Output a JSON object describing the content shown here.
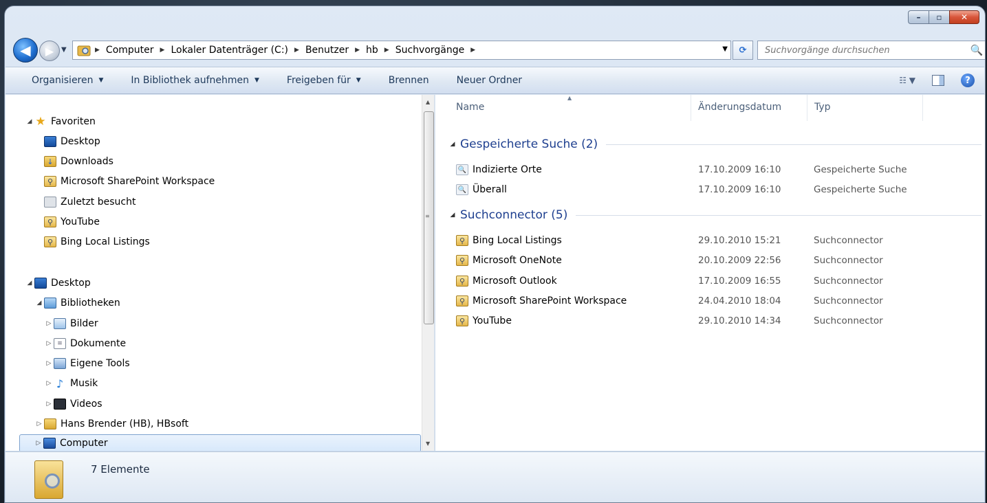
{
  "window": {
    "caption": {
      "minimize": "–",
      "maximize": "▫",
      "close": "✕"
    }
  },
  "nav": {
    "back": "◀",
    "forward": "▶",
    "history": "▼",
    "refresh": "⟳"
  },
  "address": {
    "crumbs": [
      "Computer",
      "Lokaler Datenträger (C:)",
      "Benutzer",
      "hb",
      "Suchvorgänge"
    ],
    "separator": "▶",
    "dropdown": "▼"
  },
  "search": {
    "placeholder": "Suchvorgänge durchsuchen",
    "icon": "🔍"
  },
  "toolbar": {
    "organize": "Organisieren",
    "include_library": "In Bibliothek aufnehmen",
    "share_with": "Freigeben für",
    "burn": "Brennen",
    "new_folder": "Neuer Ordner",
    "dropdown_glyph": "▼",
    "view_glyph": "☷ ▼",
    "help_glyph": "?"
  },
  "navpane": {
    "favorites": {
      "label": "Favoriten",
      "items": [
        "Desktop",
        "Downloads",
        "Microsoft SharePoint Workspace",
        "Zuletzt besucht",
        "YouTube",
        "Bing Local Listings"
      ]
    },
    "desktop": {
      "label": "Desktop",
      "libraries": {
        "label": "Bibliotheken",
        "items": [
          "Bilder",
          "Dokumente",
          "Eigene Tools",
          "Musik",
          "Videos"
        ]
      },
      "user": "Hans Brender (HB), HBsoft",
      "computer": "Computer"
    },
    "scroll": {
      "up": "▲",
      "down": "▼",
      "grip": "≡"
    }
  },
  "columns": {
    "name": "Name",
    "modified": "Änderungsdatum",
    "type": "Typ",
    "sort_glyph": "▲"
  },
  "groups": [
    {
      "title": "Gespeicherte Suche (2)",
      "rows": [
        {
          "name": "Indizierte Orte",
          "date": "17.10.2009 16:10",
          "type": "Gespeicherte Suche"
        },
        {
          "name": "Überall",
          "date": "17.10.2009 16:10",
          "type": "Gespeicherte Suche"
        }
      ]
    },
    {
      "title": "Suchconnector (5)",
      "rows": [
        {
          "name": "Bing Local Listings",
          "date": "29.10.2010 15:21",
          "type": "Suchconnector"
        },
        {
          "name": "Microsoft OneNote",
          "date": "20.10.2009 22:56",
          "type": "Suchconnector"
        },
        {
          "name": "Microsoft Outlook",
          "date": "17.10.2009 16:55",
          "type": "Suchconnector"
        },
        {
          "name": "Microsoft SharePoint Workspace",
          "date": "24.04.2010 18:04",
          "type": "Suchconnector"
        },
        {
          "name": "YouTube",
          "date": "29.10.2010 14:34",
          "type": "Suchconnector"
        }
      ]
    }
  ],
  "details": {
    "count": "7 Elemente"
  },
  "glyphs": {
    "expanded": "◢",
    "collapsed": "▷",
    "star": "★",
    "arrow": "↓",
    "connector": "⚲",
    "search_file": "🔍"
  },
  "colors": {
    "accent": "#1e3f8f",
    "selection_border": "#7da2ce"
  }
}
